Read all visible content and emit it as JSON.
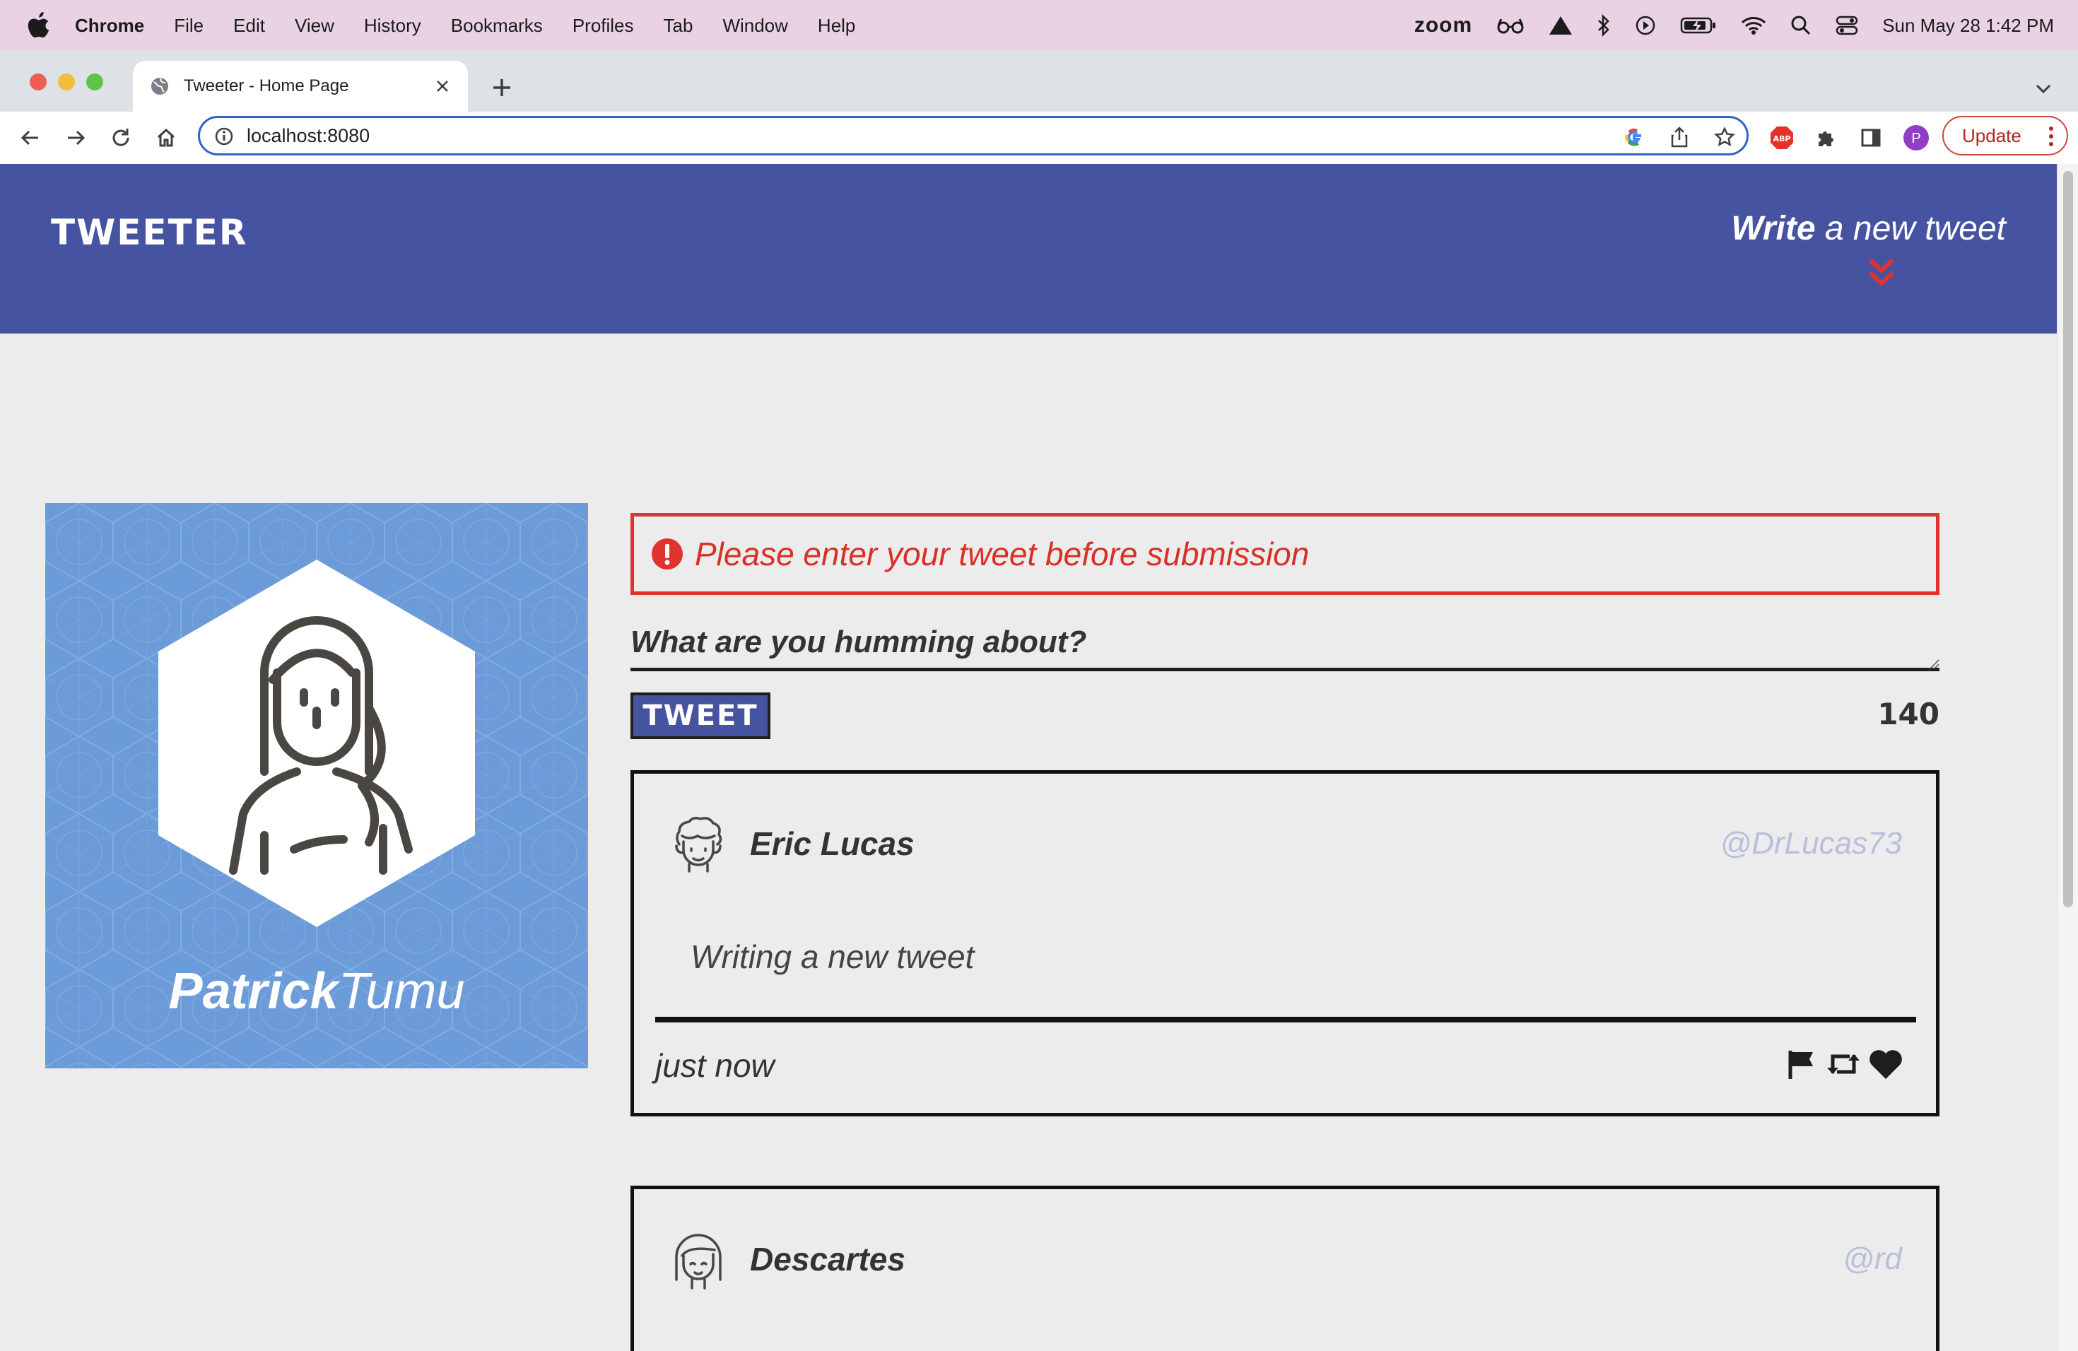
{
  "menubar": {
    "app_name": "Chrome",
    "items": [
      "File",
      "Edit",
      "View",
      "History",
      "Bookmarks",
      "Profiles",
      "Tab",
      "Window",
      "Help"
    ],
    "zoom_label": "zoom",
    "datetime": "Sun May 28  1:42 PM"
  },
  "browser": {
    "tab_title": "Tweeter - Home Page",
    "url": "localhost:8080",
    "profile_initial": "P",
    "update_label": "Update",
    "adblock_label": "ABP"
  },
  "site": {
    "logo": "TWEETER",
    "write_strong": "Write",
    "write_rest": " a new tweet"
  },
  "profile": {
    "first_name": "Patrick",
    "last_name": "Tumu"
  },
  "compose": {
    "error_message": "Please enter your tweet before submission",
    "placeholder": "What are you humming about?",
    "submit_label": "TWEET",
    "char_count": "140"
  },
  "tweets": [
    {
      "author": "Eric Lucas",
      "handle": "@DrLucas73",
      "content": "Writing a new tweet",
      "time": "just now"
    },
    {
      "author": "Descartes",
      "handle": "@rd"
    }
  ],
  "colors": {
    "header_bg": "#4653a0",
    "profile_bg": "#6b9bd8",
    "error": "#e0322e",
    "handle": "#b9bfda",
    "page_bg": "#ececec"
  }
}
